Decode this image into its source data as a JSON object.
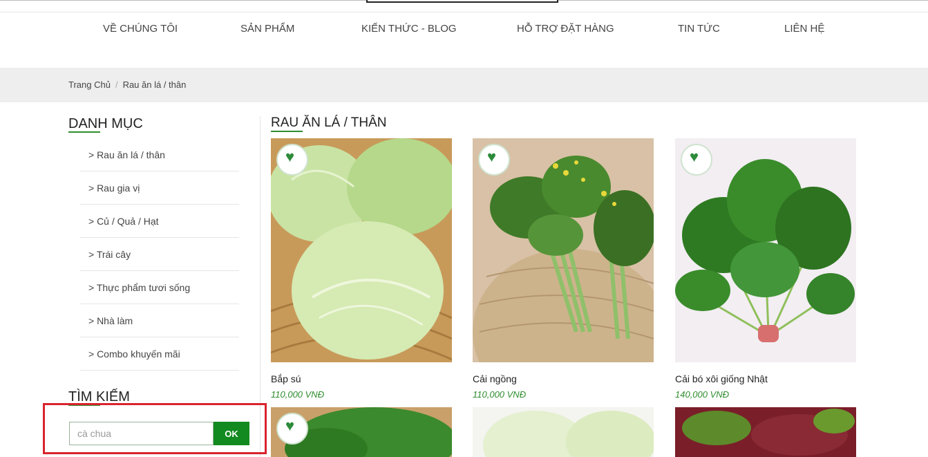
{
  "nav": {
    "items": [
      "VỀ CHÚNG TÔI",
      "SẢN PHẨM",
      "KIẾN THỨC - BLOG",
      "HỖ TRỢ ĐẶT HÀNG",
      "TIN TỨC",
      "LIÊN HỆ"
    ]
  },
  "breadcrumb": {
    "home": "Trang Chủ",
    "separator": "/",
    "current": "Rau ăn lá / thân"
  },
  "sidebar": {
    "title": "DANH MỤC",
    "categories": [
      "> Rau ăn lá / thân",
      "> Rau gia vị",
      "> Củ / Quả / Hạt",
      "> Trái cây",
      "> Thực phẩm tươi sống",
      "> Nhà làm",
      "> Combo khuyến mãi"
    ]
  },
  "search": {
    "title": "TÌM KIẾM",
    "value": "cà chua",
    "button": "OK"
  },
  "main": {
    "title": "RAU ĂN LÁ / THÂN",
    "products": [
      {
        "name": "Bắp sú",
        "price": "110,000 VNĐ"
      },
      {
        "name": "Cải ngồng",
        "price": "110,000 VNĐ"
      },
      {
        "name": "Cải bó xôi giống Nhật",
        "price": "140,000 VNĐ"
      }
    ]
  },
  "colors": {
    "accent": "#2f8d2f",
    "button": "#128a1f",
    "highlight": "#d9232e"
  }
}
